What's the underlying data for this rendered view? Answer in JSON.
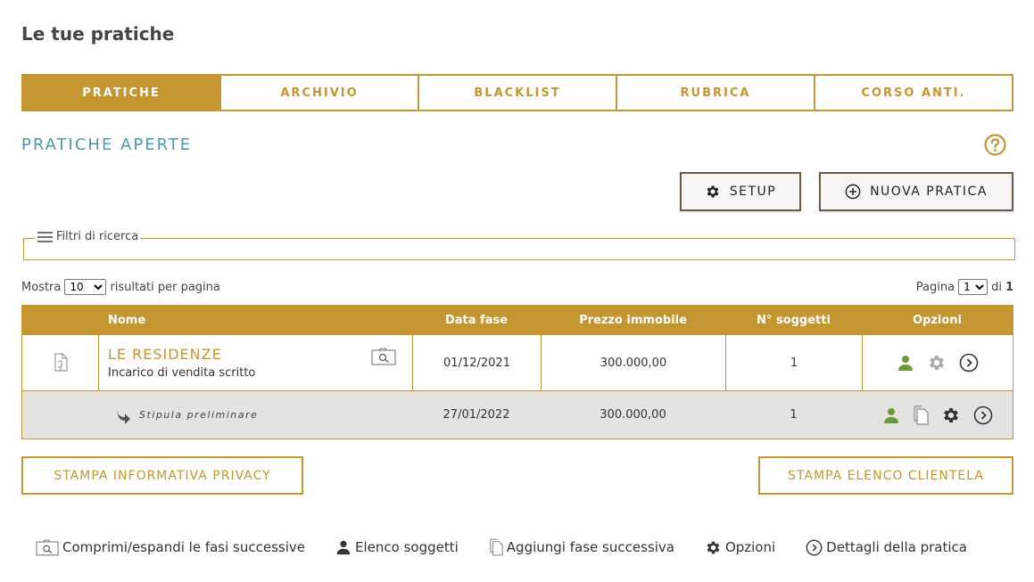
{
  "page": {
    "title": "Le tue pratiche"
  },
  "tabs": [
    {
      "label": "PRATICHE",
      "active": true
    },
    {
      "label": "ARCHIVIO",
      "active": false
    },
    {
      "label": "BLACKLIST",
      "active": false
    },
    {
      "label": "RUBRICA",
      "active": false
    },
    {
      "label": "CORSO ANTI.",
      "active": false
    }
  ],
  "section": {
    "title": "PRATICHE APERTE"
  },
  "toolbar": {
    "setup_label": "SETUP",
    "new_label": "NUOVA PRATICA"
  },
  "filters": {
    "label": "Filtri di ricerca"
  },
  "pagination": {
    "show_prefix": "Mostra",
    "page_size": "10",
    "show_suffix": "risultati per pagina",
    "page_prefix": "Pagina",
    "page_current": "1",
    "page_of": "di",
    "page_total": "1"
  },
  "table": {
    "headers": {
      "name": "Nome",
      "date": "Data fase",
      "price": "Prezzo immobile",
      "subjects": "N° soggetti",
      "options": "Opzioni"
    },
    "row": {
      "name": "LE RESIDENZE",
      "subtitle": "Incarico di vendita scritto",
      "date": "01/12/2021",
      "price": "300.000,00",
      "subjects": "1"
    },
    "subrow": {
      "phase": "Stipula preliminare",
      "date": "27/01/2022",
      "price": "300.000,00",
      "subjects": "1"
    }
  },
  "buttons": {
    "privacy": "STAMPA INFORMATIVA PRIVACY",
    "clients": "STAMPA ELENCO CLIENTELA"
  },
  "legend": {
    "expand": "Comprimi/espandi le fasi successive",
    "subjects": "Elenco soggetti",
    "add_phase": "Aggiungi fase successiva",
    "options": "Opzioni",
    "details": "Dettagli della pratica"
  },
  "colors": {
    "accent": "#c39631",
    "teal": "#4a9aa8",
    "green": "#6b9a3a",
    "row_alt": "#e5e3df"
  }
}
